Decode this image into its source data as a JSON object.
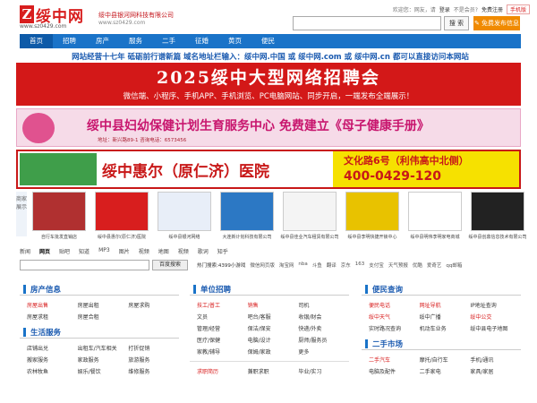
{
  "logo": {
    "mark": "Z",
    "name": "绥中网",
    "domain": "www.sz0429.com"
  },
  "company": {
    "name": "绥中县银河网科技有限公司",
    "url": "www.sz0429.com"
  },
  "topbar": {
    "welcome": "欢迎您：网友，请",
    "login": "登录",
    "not_member": "不是会员?",
    "register": "免费注册",
    "mobile": "手机版"
  },
  "search": {
    "placeholder": "",
    "button": "搜 索"
  },
  "post_button": "✎ 免费发布信息",
  "nav": [
    {
      "label": "首页",
      "on": true
    },
    {
      "label": "招聘",
      "on": false
    },
    {
      "label": "房产",
      "on": false
    },
    {
      "label": "服务",
      "on": false
    },
    {
      "label": "二手",
      "on": false
    },
    {
      "label": "征婚",
      "on": false
    },
    {
      "label": "黄页",
      "on": false
    },
    {
      "label": "便民",
      "on": false
    }
  ],
  "notice": "网站经营十七年 砥砺前行谱新篇 域名地址栏输入：绥中网.中国 或 绥中网.com 或 绥中网.cn 都可以直接访问本网站",
  "banner1": {
    "title": "2025绥中大型网络招聘会",
    "subtitle": "微信端、小程序、手机APP、手机浏览、PC电脑网站、同步开启，一端发布全端展示！"
  },
  "banner2": {
    "title": "绥中县妇幼保健计划生育服务中心 免费建立《母子健康手册》",
    "sub": "地址：新兴路89-1 咨询电话：6573456"
  },
  "banner3": {
    "title": "绥中惠尔（原仁济）医院",
    "addr": "文化路6号（利伟高中北侧）",
    "phone": "400-0429-120"
  },
  "featured": {
    "label": "商家展示",
    "items": [
      {
        "caption": "自行车批发直销店"
      },
      {
        "caption": "绥中县惠尔(原仁济)医院"
      },
      {
        "caption": "绥中县银河网络"
      },
      {
        "caption": "大连新计划科技有限公司"
      },
      {
        "caption": "绥中县佳业汽车租赁有限公司"
      },
      {
        "caption": "绥中县李明快捷开锁中心"
      },
      {
        "caption": "绥中县明伟李明家电商城"
      },
      {
        "caption": "绥中县创鼎信息技术有限公司"
      }
    ]
  },
  "site_search": {
    "tabs": [
      "新闻",
      "网页",
      "贴吧",
      "知道",
      "MP3",
      "图片",
      "视频",
      "地图",
      "视频",
      "歌词",
      "知乎"
    ],
    "active_tab": 1,
    "button": "百度搜索",
    "hot": [
      "热门搜索:4399小游戏",
      "微信网页版",
      "淘宝网",
      "nba",
      "斗鱼",
      "翻译",
      "京东",
      "163",
      "支付宝",
      "天气预报",
      "优酷",
      "爱奇艺",
      "qq邮箱"
    ]
  },
  "panels": {
    "house": {
      "title": "房产信息",
      "items": [
        [
          "房屋出售",
          "房屋出租",
          "房屋求购"
        ],
        [
          "房屋求租",
          "房屋合租",
          ""
        ]
      ]
    },
    "life": {
      "title": "生活服务",
      "items": [
        [
          "店铺出兑",
          "出租车/汽车相关",
          "打折促销"
        ],
        [
          "搬家服务",
          "家政服务",
          "旅游服务"
        ],
        [
          "农林牧鱼",
          "娱乐/餐饮",
          "维修服务"
        ]
      ]
    },
    "jobs": {
      "title": "单位招聘",
      "items": [
        [
          "技工/普工",
          "销售",
          "司机"
        ],
        [
          "文员",
          "吧台/客服",
          "收银/财会"
        ],
        [
          "管理/经营",
          "保洁/保安",
          "快递/外卖"
        ],
        [
          "医疗/保健",
          "电脑/设计",
          "厨师/服务员"
        ],
        [
          "家教/辅导",
          "保姆/家政",
          "更多"
        ]
      ],
      "sub": [
        [
          "求职简历",
          "兼职求职",
          "毕业/实习"
        ]
      ]
    },
    "convenience": {
      "title": "便民查询",
      "items": [
        [
          "便民电话",
          "网址导航",
          "IP地址查询"
        ],
        [
          "绥中天气",
          "绥中广播",
          "绥中公交"
        ],
        [
          "实时路况查询",
          "机动车业务",
          "绥中县电子地图"
        ]
      ]
    },
    "secondhand": {
      "title": "二手市场",
      "items": [
        [
          "二手汽车",
          "摩托/自行车",
          "手机/通讯"
        ],
        [
          "电脑及配件",
          "二手家电",
          "家具/家居"
        ],
        [
          "",
          "",
          ""
        ]
      ]
    }
  },
  "colors": {
    "brand_red": "#d81e1e",
    "nav_blue": "#1a73c8",
    "orange": "#f08a00"
  }
}
